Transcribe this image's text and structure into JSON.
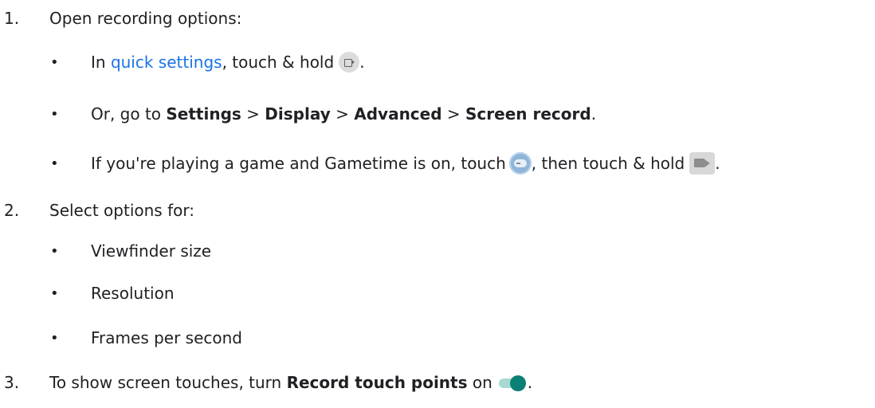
{
  "steps": [
    {
      "number": "1.",
      "text": "Open recording options:"
    },
    {
      "number": "2.",
      "text": "Select options for:"
    },
    {
      "number": "3.",
      "text_before": "To show screen touches, turn ",
      "bold": "Record touch points",
      "text_after": " on"
    }
  ],
  "step1_bullets": {
    "b1": {
      "before": "In ",
      "link": "quick settings",
      "after": ", touch & hold",
      "end": "."
    },
    "b2": {
      "before": "Or, go to ",
      "p1": "Settings",
      "sep1": " > ",
      "p2": "Display",
      "sep2": " > ",
      "p3": "Advanced",
      "sep3": " > ",
      "p4": "Screen record",
      "end": "."
    },
    "b3": {
      "before": "If you're playing a game and Gametime is on, touch",
      "middle": ", then touch & hold",
      "end": "."
    }
  },
  "step2_bullets": [
    "Viewfinder size",
    "Resolution",
    "Frames per second"
  ],
  "bullet_char": "•",
  "icons": {
    "record": "screen-record-icon",
    "gametime": "gametime-icon",
    "video": "video-camera-icon",
    "toggle": "toggle-on-icon"
  },
  "colors": {
    "link": "#1a73e8",
    "toggle": "#0b8074",
    "text": "#202124"
  }
}
